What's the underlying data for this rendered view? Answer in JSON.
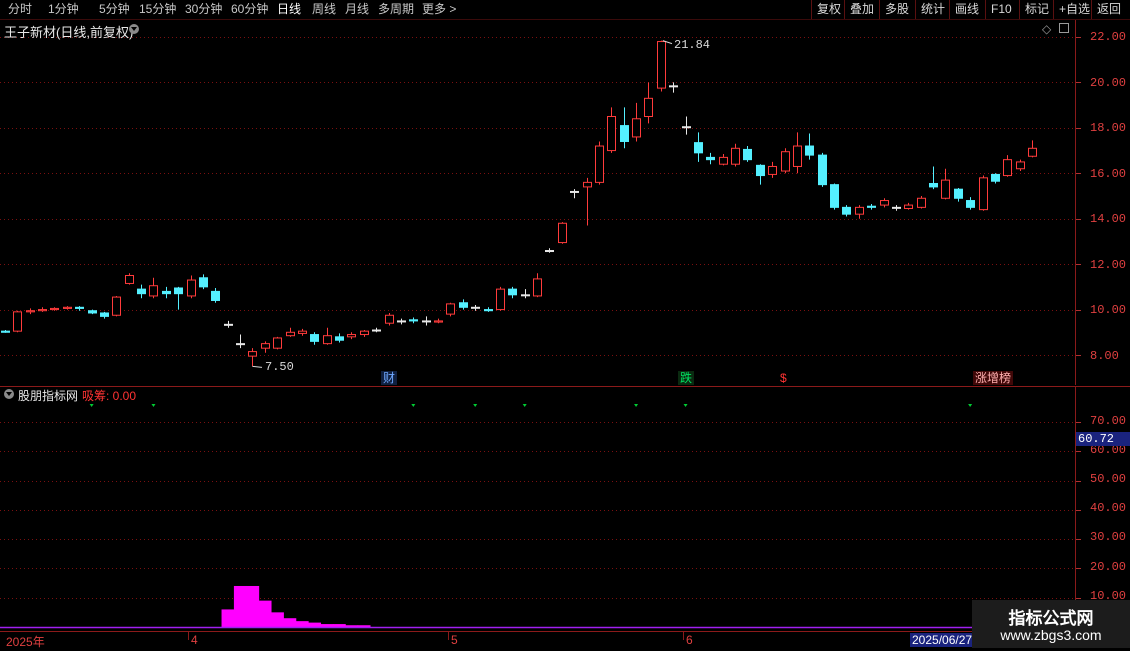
{
  "toolbar": {
    "periods": [
      "分时",
      "1分钟",
      "5分钟",
      "15分钟",
      "30分钟",
      "60分钟",
      "日线",
      "周线",
      "月线",
      "多周期",
      "更多 >"
    ],
    "active_period": "日线",
    "actions": [
      "复权",
      "叠加",
      "多股",
      "统计",
      "画线",
      "F10",
      "标记",
      "+自选",
      "返回"
    ]
  },
  "main_pane": {
    "title": "王子新材(日线,前复权)",
    "high_annotation": "21.84",
    "low_annotation": "7.50",
    "events": [
      {
        "label": "财",
        "color": "#6fa8ff",
        "bg": "#102040"
      },
      {
        "label": "跌",
        "color": "#00e060",
        "bg": "#0a2a10"
      },
      {
        "label": "$",
        "color": "#ff3333",
        "bg": "#000000"
      },
      {
        "label": "涨增榜",
        "color": "#ffb0b0",
        "bg": "#400808"
      }
    ]
  },
  "price_axis": {
    "labels": [
      "22.00",
      "20.00",
      "18.00",
      "16.00",
      "14.00",
      "12.00",
      "10.00",
      "8.00"
    ],
    "values": [
      22,
      20,
      18,
      16,
      14,
      12,
      10,
      8
    ]
  },
  "indicator_pane": {
    "title": "股朋指标网",
    "metric_label": "吸筹: 0.00",
    "axis_labels": [
      "70.00",
      "60.00",
      "50.00",
      "40.00",
      "30.00",
      "20.00",
      "10.00"
    ],
    "axis_values": [
      70,
      60,
      50,
      40,
      30,
      20,
      10
    ],
    "cursor_value": "60.72"
  },
  "date_axis": {
    "labels": [
      "2025年",
      "4",
      "5",
      "6"
    ],
    "highlight": "2025/06/27"
  },
  "watermark": {
    "title": "指标公式网",
    "url": "www.zbgs3.com"
  },
  "colors": {
    "up": "#ff3b3b",
    "down": "#54f0ff",
    "doji": "#e8e8e8",
    "grid": "#7a1010",
    "hist": "#ff00ff",
    "marker": "#00cc33"
  },
  "chart_data": {
    "type": "candlestick",
    "candles": [
      [
        9.05,
        9.0,
        9.1,
        8.98
      ],
      [
        9.05,
        9.9,
        9.95,
        9.0
      ],
      [
        9.9,
        9.95,
        10.05,
        9.8
      ],
      [
        9.95,
        10.0,
        10.1,
        9.9
      ],
      [
        10.0,
        10.05,
        10.1,
        9.95
      ],
      [
        10.05,
        10.1,
        10.15,
        10.0
      ],
      [
        10.1,
        10.05,
        10.15,
        9.95
      ],
      [
        9.95,
        9.85,
        10.0,
        9.8
      ],
      [
        9.85,
        9.7,
        9.9,
        9.6
      ],
      [
        9.75,
        10.55,
        10.6,
        9.7
      ],
      [
        11.15,
        11.5,
        11.6,
        11.1
      ],
      [
        10.9,
        10.7,
        11.1,
        10.5
      ],
      [
        10.6,
        11.05,
        11.4,
        10.5
      ],
      [
        10.8,
        10.7,
        11.0,
        10.5
      ],
      [
        10.95,
        10.7,
        11.0,
        10.0
      ],
      [
        10.6,
        11.3,
        11.5,
        10.5
      ],
      [
        11.4,
        11.0,
        11.55,
        10.9
      ],
      [
        10.8,
        10.4,
        10.95,
        10.3
      ],
      [
        9.35,
        9.35,
        9.5,
        9.2
      ],
      [
        8.5,
        8.5,
        8.9,
        8.3
      ],
      [
        7.95,
        8.15,
        8.3,
        7.5
      ],
      [
        8.3,
        8.5,
        8.6,
        8.1
      ],
      [
        8.3,
        8.75,
        8.8,
        8.25
      ],
      [
        8.85,
        9.0,
        9.2,
        8.8
      ],
      [
        8.95,
        9.05,
        9.15,
        8.85
      ],
      [
        8.9,
        8.6,
        9.0,
        8.45
      ],
      [
        8.5,
        8.85,
        9.2,
        8.45
      ],
      [
        8.8,
        8.65,
        8.95,
        8.55
      ],
      [
        8.8,
        8.9,
        9.0,
        8.7
      ],
      [
        8.9,
        9.05,
        9.1,
        8.8
      ],
      [
        9.1,
        9.1,
        9.2,
        9.0
      ],
      [
        9.4,
        9.75,
        9.85,
        9.3
      ],
      [
        9.5,
        9.5,
        9.6,
        9.35
      ],
      [
        9.55,
        9.5,
        9.65,
        9.4
      ],
      [
        9.5,
        9.5,
        9.7,
        9.3
      ],
      [
        9.45,
        9.5,
        9.6,
        9.4
      ],
      [
        9.8,
        10.25,
        10.3,
        9.7
      ],
      [
        10.3,
        10.1,
        10.45,
        10.0
      ],
      [
        10.1,
        10.1,
        10.2,
        9.95
      ],
      [
        10.0,
        9.95,
        10.1,
        9.9
      ],
      [
        10.0,
        10.9,
        11.0,
        9.95
      ],
      [
        10.9,
        10.65,
        11.0,
        10.5
      ],
      [
        10.65,
        10.65,
        10.9,
        10.5
      ],
      [
        10.6,
        11.35,
        11.6,
        10.55
      ],
      [
        12.6,
        12.6,
        12.7,
        12.5
      ],
      [
        12.95,
        13.8,
        13.85,
        12.9
      ],
      [
        15.2,
        15.2,
        15.3,
        14.9
      ],
      [
        15.4,
        15.6,
        15.8,
        13.7
      ],
      [
        15.6,
        17.2,
        17.4,
        15.5
      ],
      [
        17.0,
        18.5,
        18.9,
        16.9
      ],
      [
        18.1,
        17.4,
        18.9,
        17.1
      ],
      [
        17.6,
        18.4,
        19.1,
        17.4
      ],
      [
        18.5,
        19.3,
        20.0,
        18.2
      ],
      [
        19.75,
        21.8,
        21.84,
        19.6
      ],
      [
        19.85,
        19.85,
        20.0,
        19.55
      ],
      [
        18.05,
        18.05,
        18.5,
        17.7
      ],
      [
        17.35,
        16.9,
        17.8,
        16.5
      ],
      [
        16.7,
        16.6,
        16.9,
        16.4
      ],
      [
        16.4,
        16.7,
        16.85,
        16.35
      ],
      [
        16.4,
        17.1,
        17.3,
        16.3
      ],
      [
        17.05,
        16.6,
        17.2,
        16.5
      ],
      [
        16.35,
        15.9,
        16.4,
        15.5
      ],
      [
        15.95,
        16.3,
        16.5,
        15.8
      ],
      [
        16.1,
        16.95,
        17.1,
        16.0
      ],
      [
        16.3,
        17.2,
        17.8,
        16.0
      ],
      [
        17.2,
        16.8,
        17.75,
        16.6
      ],
      [
        16.8,
        15.5,
        16.9,
        15.4
      ],
      [
        15.5,
        14.5,
        15.55,
        14.4
      ],
      [
        14.5,
        14.2,
        14.6,
        14.1
      ],
      [
        14.2,
        14.5,
        14.6,
        14.0
      ],
      [
        14.55,
        14.5,
        14.65,
        14.4
      ],
      [
        14.6,
        14.8,
        14.9,
        14.5
      ],
      [
        14.5,
        14.5,
        14.6,
        14.35
      ],
      [
        14.45,
        14.6,
        14.7,
        14.4
      ],
      [
        14.5,
        14.9,
        15.0,
        14.45
      ],
      [
        15.55,
        15.4,
        16.3,
        15.3
      ],
      [
        14.9,
        15.7,
        16.2,
        14.85
      ],
      [
        15.3,
        14.9,
        15.35,
        14.75
      ],
      [
        14.8,
        14.5,
        14.95,
        14.4
      ],
      [
        14.4,
        15.8,
        15.9,
        14.35
      ],
      [
        15.95,
        15.65,
        16.0,
        15.55
      ],
      [
        15.9,
        16.6,
        16.8,
        15.85
      ],
      [
        16.2,
        16.5,
        16.6,
        16.1
      ],
      [
        16.75,
        17.1,
        17.45,
        16.7
      ]
    ],
    "markers": [
      7,
      12,
      33,
      38,
      42,
      51,
      55,
      78
    ],
    "histogram": {
      "start": 18,
      "values": [
        6,
        14,
        14,
        9,
        5,
        3,
        2,
        1.5,
        1,
        1,
        0.6,
        0.6
      ]
    }
  }
}
